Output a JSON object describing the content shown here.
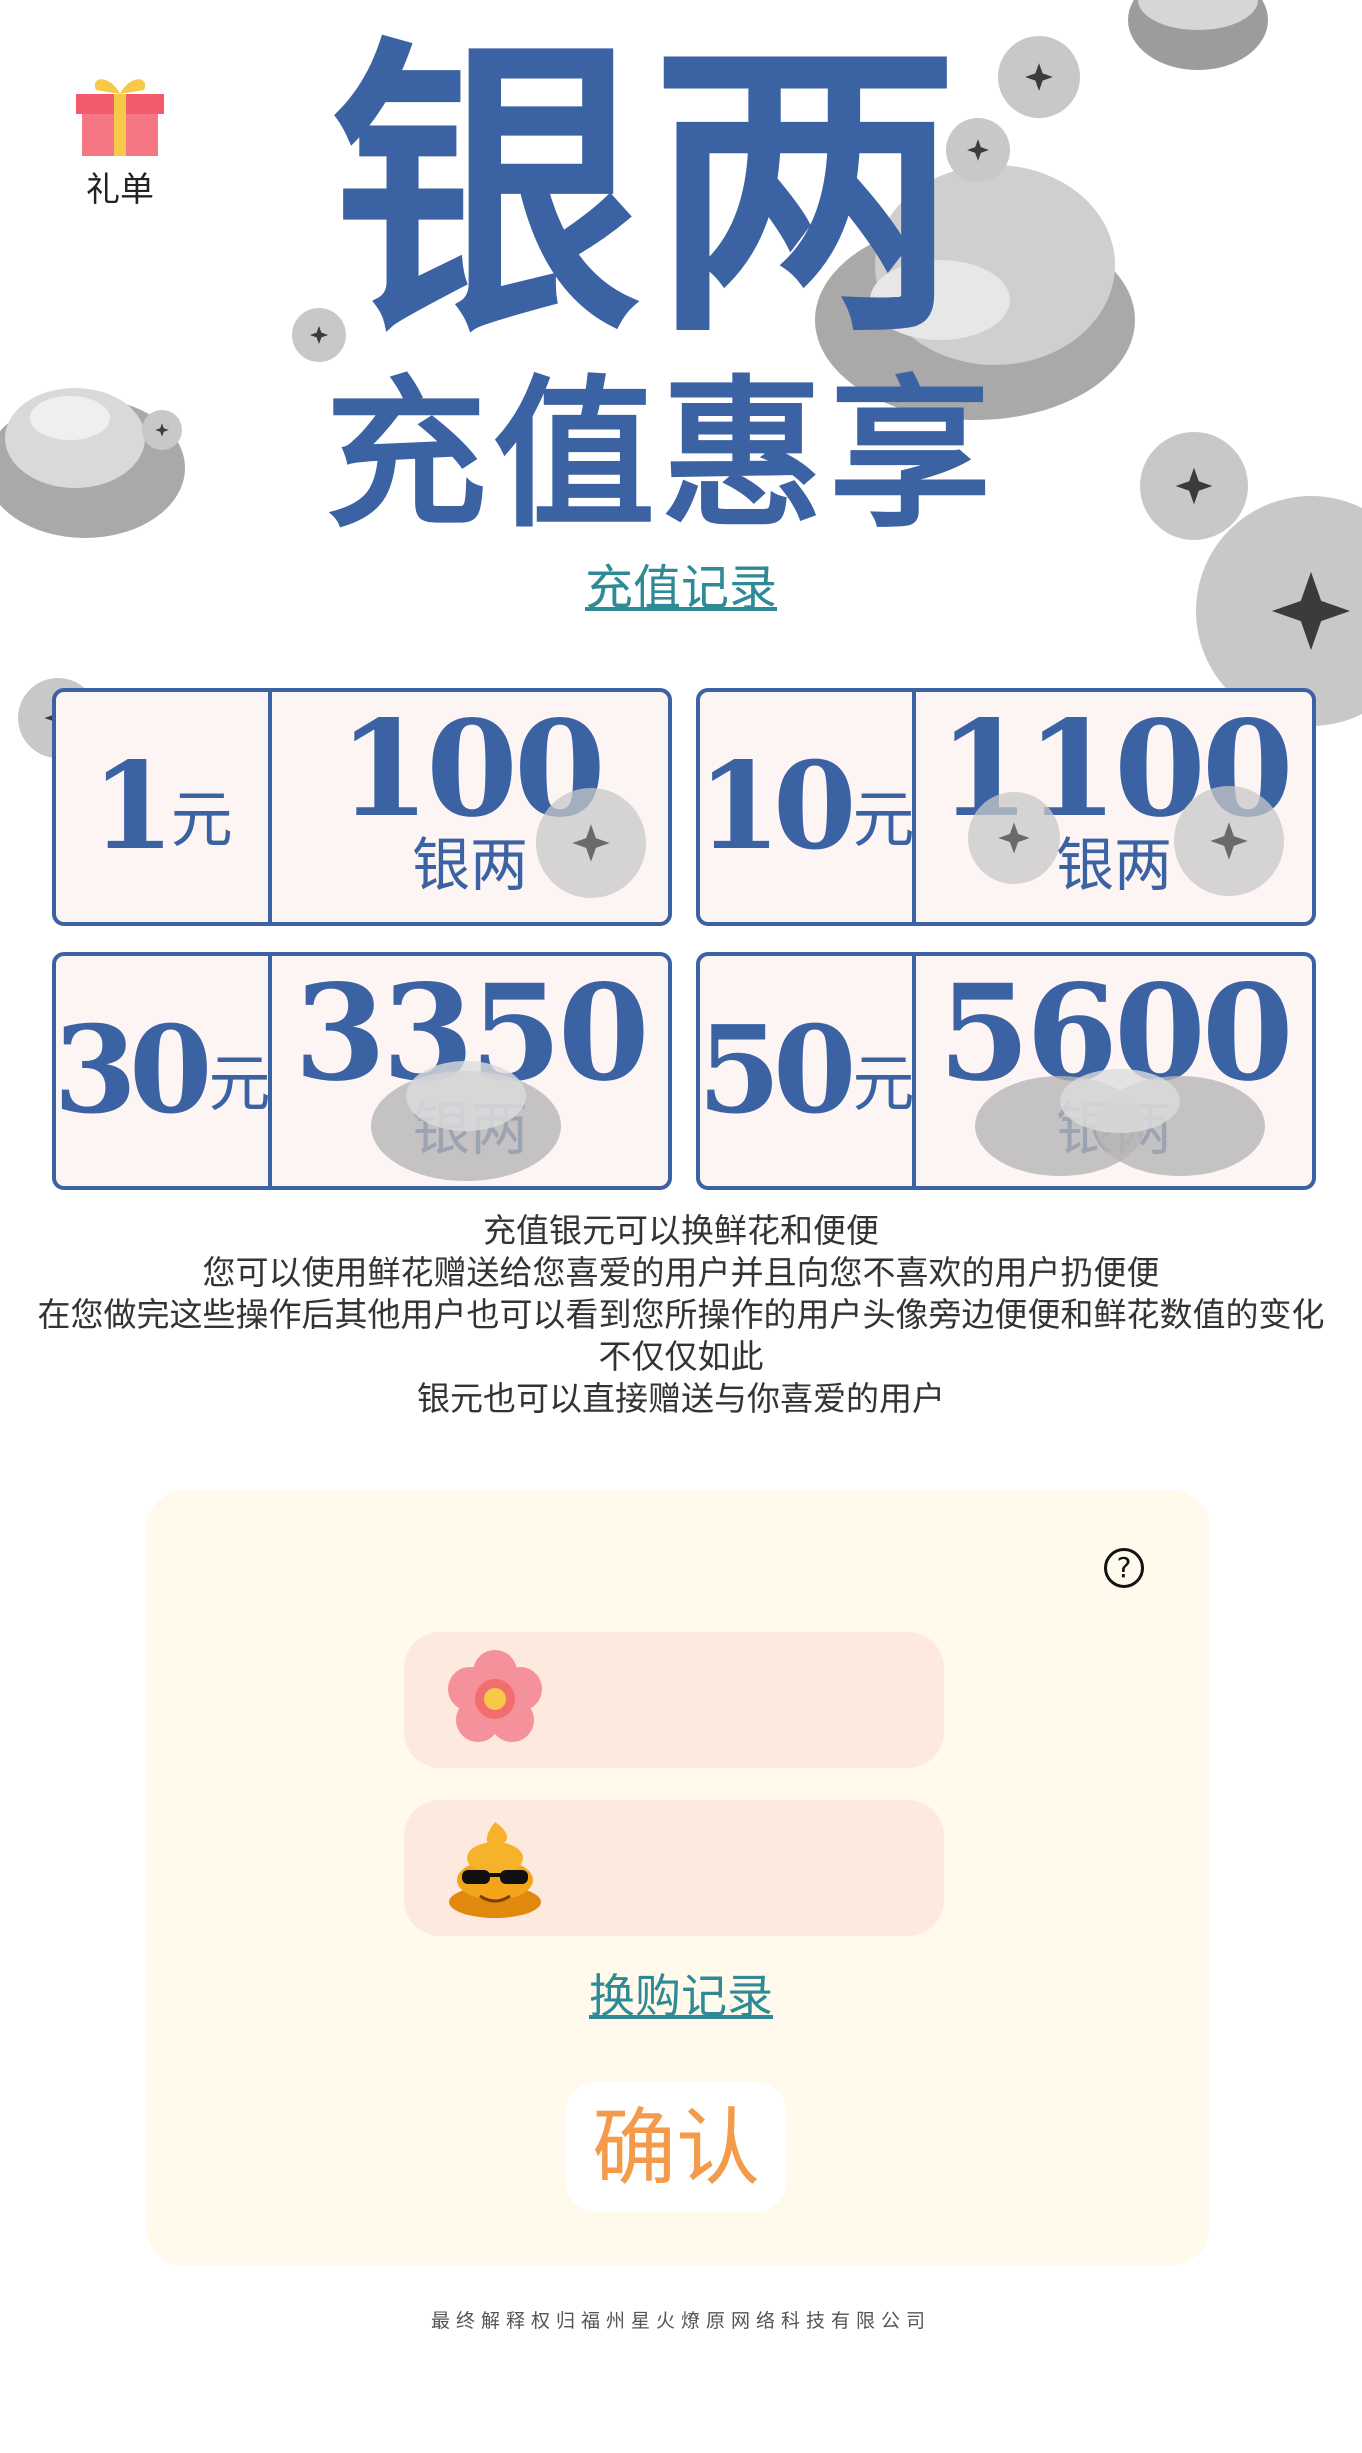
{
  "header": {
    "gift_label": "礼单",
    "title_main": "银两",
    "title_sub": "充值惠享",
    "recharge_record_link": "充值记录"
  },
  "packages": [
    {
      "price": "1",
      "unit": "元",
      "amount": "100",
      "amount_unit": "银两"
    },
    {
      "price": "10",
      "unit": "元",
      "amount": "1100",
      "amount_unit": "银两"
    },
    {
      "price": "30",
      "unit": "元",
      "amount": "3350",
      "amount_unit": "银两"
    },
    {
      "price": "50",
      "unit": "元",
      "amount": "5600",
      "amount_unit": "银两"
    }
  ],
  "description": [
    "充值银元可以换鲜花和便便",
    "您可以使用鲜花赠送给您喜爱的用户并且向您不喜欢的用户扔便便",
    "在您做完这些操作后其他用户也可以看到您所操作的用户头像旁边便便和鲜花数值的变化",
    "不仅仅如此",
    "银元也可以直接赠送与你喜爱的用户"
  ],
  "exchange": {
    "help_icon": "?",
    "flower_icon": "flower-icon",
    "poop_icon": "poop-with-sunglasses-icon",
    "flower_value": "",
    "poop_value": "",
    "record_link": "换购记录",
    "confirm_label": "确认"
  },
  "footer": "最终解释权归福州星火燎原网络科技有限公司",
  "colors": {
    "brand_blue": "#3b62a3",
    "link_teal": "#2f8a96",
    "confirm_orange": "#f39a4b",
    "panel_bg": "#fffaec",
    "field_bg": "#fde9dd",
    "card_bg": "#fdf4f4"
  }
}
